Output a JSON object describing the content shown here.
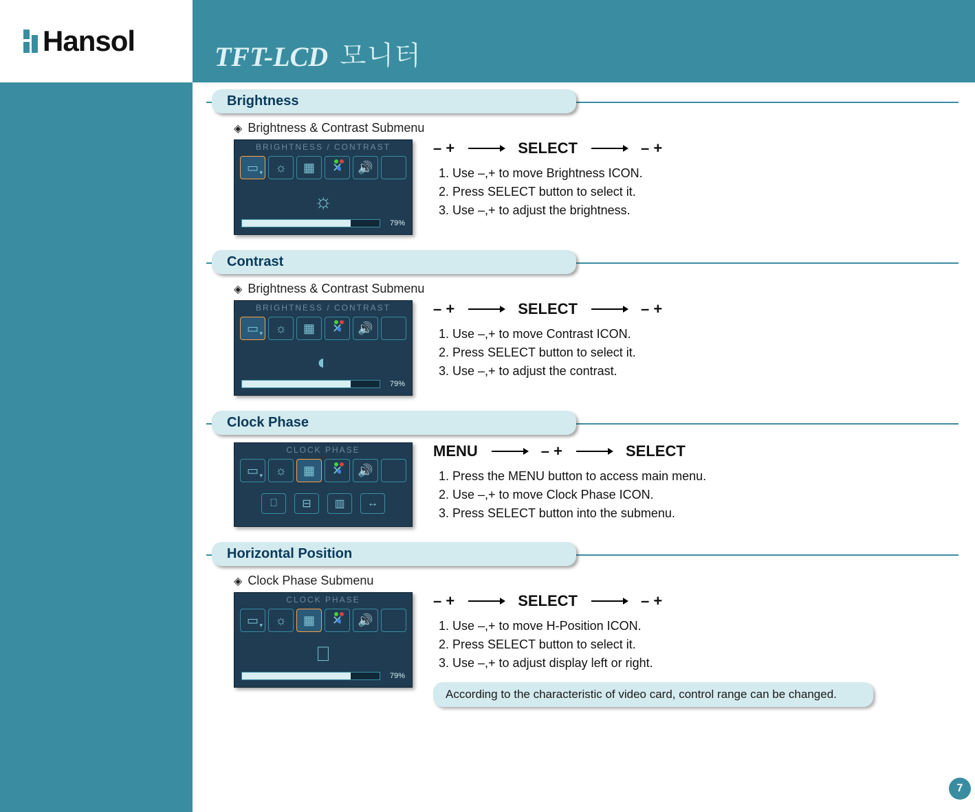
{
  "logo": "Hansol",
  "banner": {
    "title_en": "TFT-LCD",
    "title_kr": "모니터"
  },
  "page_number": "7",
  "sections": [
    {
      "heading": "Brightness",
      "subline": "Brightness & Contrast Submenu",
      "osd": {
        "title": "BRIGHTNESS / CONTRAST",
        "center_icon": "brightness",
        "show_bar": true,
        "percent": "79%",
        "bar_pct": 79,
        "show_sub_icons": false,
        "sel_tab": 0
      },
      "arrows": [
        "–  +",
        "SELECT",
        "–  +"
      ],
      "steps": [
        "1. Use –,+ to move Brightness ICON.",
        "2. Press SELECT button to select it.",
        "3. Use –,+ to adjust the brightness."
      ],
      "note": ""
    },
    {
      "heading": "Contrast",
      "subline": "Brightness & Contrast  Submenu",
      "osd": {
        "title": "BRIGHTNESS / CONTRAST",
        "center_icon": "contrast",
        "show_bar": true,
        "percent": "79%",
        "bar_pct": 79,
        "show_sub_icons": false,
        "sel_tab": 0
      },
      "arrows": [
        "–  +",
        "SELECT",
        "–  +"
      ],
      "steps": [
        "1. Use –,+ to move Contrast ICON.",
        "2. Press SELECT button to select it.",
        "3. Use –,+ to adjust the contrast."
      ],
      "note": ""
    },
    {
      "heading": "Clock Phase",
      "subline": "",
      "osd": {
        "title": "CLOCK PHASE",
        "center_icon": "",
        "show_bar": false,
        "percent": "",
        "bar_pct": 0,
        "show_sub_icons": true,
        "sel_tab": 2
      },
      "arrows": [
        "MENU",
        "–  +",
        "SELECT"
      ],
      "steps": [
        "1. Press the MENU button to access main menu.",
        "2. Use –,+ to move Clock Phase ICON.",
        "3. Press SELECT button into the submenu."
      ],
      "note": ""
    },
    {
      "heading": "Horizontal Position",
      "subline": "Clock Phase Submenu",
      "osd": {
        "title": "CLOCK PHASE",
        "center_icon": "hpos",
        "show_bar": true,
        "percent": "79%",
        "bar_pct": 79,
        "show_sub_icons": false,
        "sel_tab": 2
      },
      "arrows": [
        "–  +",
        "SELECT",
        "–  +"
      ],
      "steps": [
        "1. Use –,+ to move H-Position ICON.",
        "2. Press SELECT button to select it.",
        "3. Use –,+ to adjust display left or right."
      ],
      "note": "According to the characteristic of video card, control range can be changed."
    }
  ]
}
